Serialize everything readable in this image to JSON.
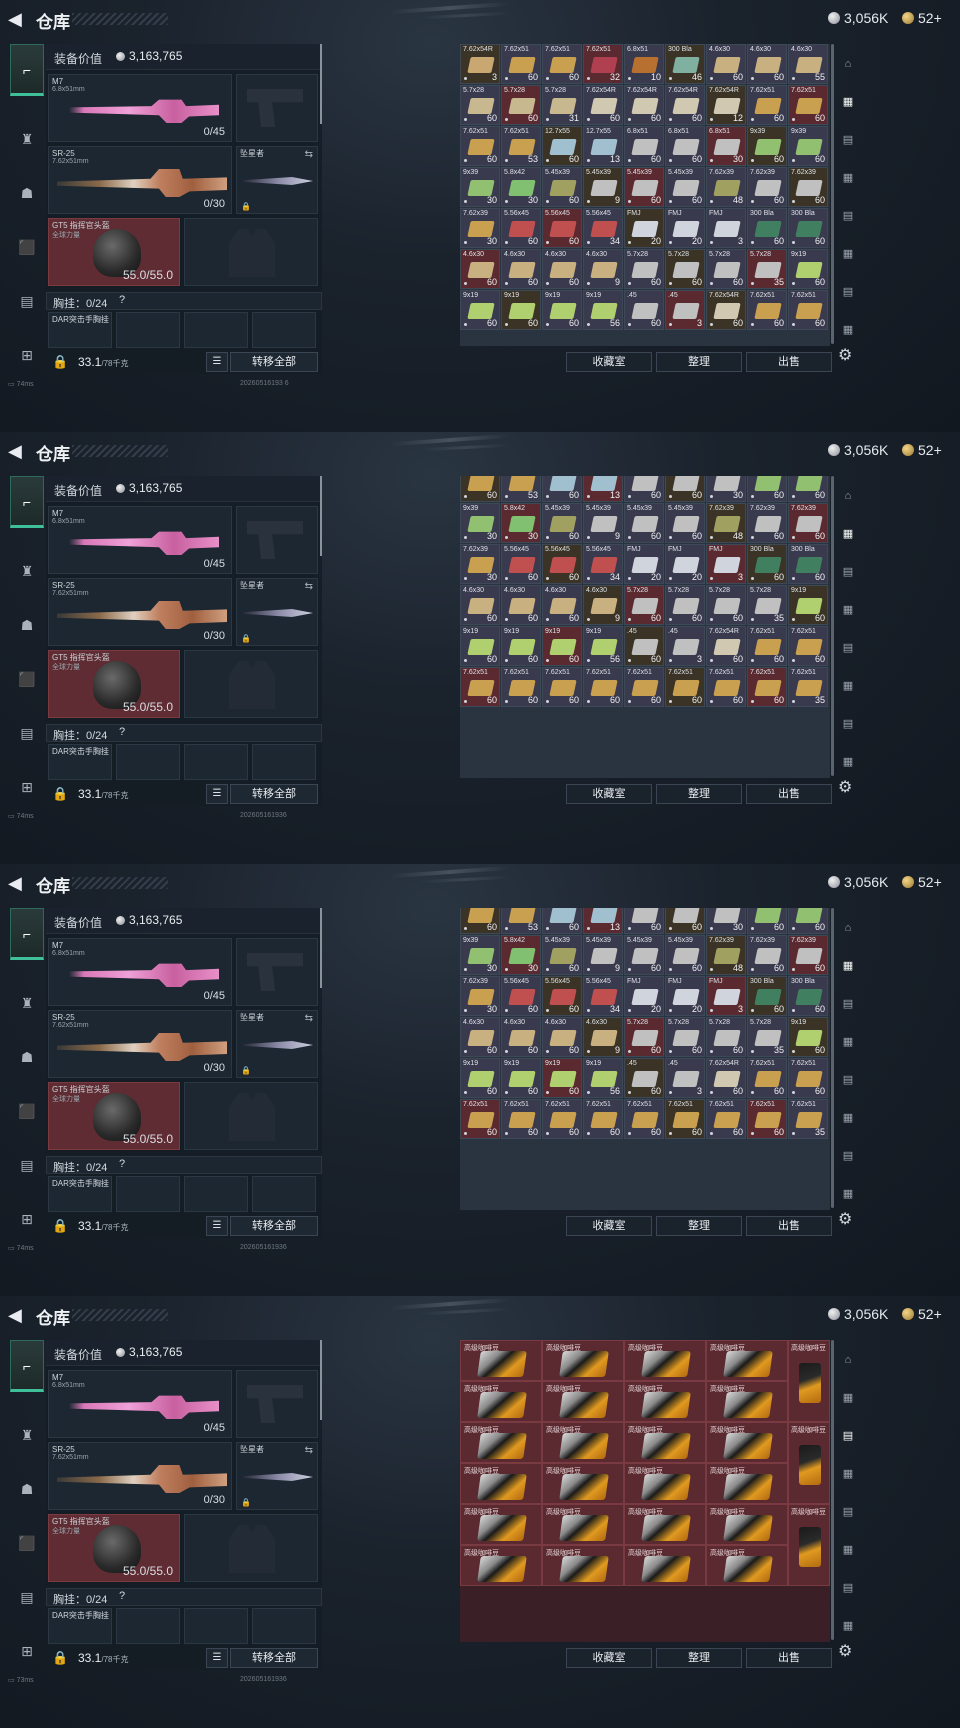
{
  "header": {
    "back_icon": "back-arrow-icon",
    "title": "仓库"
  },
  "currency": {
    "silver": "3,056K",
    "gold": "52+"
  },
  "side_tabs": [
    "weapons-tab",
    "armor-tab",
    "backpack-tab",
    "bag-tab",
    "case-tab",
    "toolbox-tab"
  ],
  "loadout": {
    "value_label": "装备价值",
    "value": "3,163,765",
    "primary": {
      "name": "M7",
      "caliber": "6.8x51mm",
      "ammo": "0/45"
    },
    "secondary": {
      "name": "SR-25",
      "caliber": "7.62x51mm",
      "ammo": "0/30"
    },
    "melee": {
      "name": "坠星者"
    },
    "helmet": {
      "name": "GT5 指挥官头盔",
      "sub": "全球力量",
      "durability": "55.0/55.0"
    },
    "rig": {
      "label": "胸挂：",
      "value": "0/24",
      "help": "?"
    },
    "armor": {
      "name": "DAR突击手胸挂"
    },
    "weight": {
      "value": "33.1",
      "max": "/78千克"
    },
    "transfer_label": "转移全部"
  },
  "status": [
    {
      "ping": "74ms",
      "code": "20260516193 6"
    },
    {
      "ping": "74ms",
      "code": "202605161936"
    },
    {
      "ping": "74ms",
      "code": "202605161936"
    },
    {
      "ping": "73ms",
      "code": "202605161936"
    }
  ],
  "grid_buttons": {
    "collection": "收藏室",
    "sort": "整理",
    "sell": "出售"
  },
  "ammo_grid_1": [
    [
      "7.62x54R",
      "3",
      "#c8a870"
    ],
    [
      "7.62x51",
      "60",
      "#c8a050"
    ],
    [
      "7.62x51",
      "60",
      "#c8a050"
    ],
    [
      "7.62x51",
      "32",
      "#b04050"
    ],
    [
      "6.8x51",
      "10",
      "#b87030"
    ],
    [
      "300 Bla",
      "46",
      "#80b0a0"
    ],
    [
      "4.6x30",
      "60",
      "#c8b080"
    ],
    [
      "4.6x30",
      "60",
      "#c8b080"
    ],
    [
      "4.6x30",
      "55",
      "#c8b080"
    ],
    [
      "5.7x28",
      "60",
      "#c8b890"
    ],
    [
      "5.7x28",
      "60",
      "#c8b890"
    ],
    [
      "5.7x28",
      "31",
      "#c8b890"
    ],
    [
      "7.62x54R",
      "60",
      "#d0c8b0"
    ],
    [
      "7.62x54R",
      "60",
      "#d0c8b0"
    ],
    [
      "7.62x54R",
      "60",
      "#d0c8b0"
    ],
    [
      "7.62x54R",
      "12",
      "#d0c8b0"
    ],
    [
      "7.62x51",
      "60",
      "#c8a050"
    ],
    [
      "7.62x51",
      "60",
      "#c8a050"
    ],
    [
      "7.62x51",
      "60",
      "#c8a050"
    ],
    [
      "7.62x51",
      "53",
      "#c8a050"
    ],
    [
      "12.7x55",
      "60",
      "#a0c0d0"
    ],
    [
      "12.7x55",
      "13",
      "#a0c0d0"
    ],
    [
      "6.8x51",
      "60",
      "#c0c0c0"
    ],
    [
      "6.8x51",
      "60",
      "#c0c0c0"
    ],
    [
      "6.8x51",
      "30",
      "#c0c0c0"
    ],
    [
      "9x39",
      "60",
      "#90c070"
    ],
    [
      "9x39",
      "60",
      "#90c070"
    ],
    [
      "9x39",
      "30",
      "#90c070"
    ],
    [
      "5.8x42",
      "30",
      "#80c070"
    ],
    [
      "5.45x39",
      "60",
      "#a0a060"
    ],
    [
      "5.45x39",
      "9",
      "#c0c0c0"
    ],
    [
      "5.45x39",
      "60",
      "#c0c0c0"
    ],
    [
      "5.45x39",
      "60",
      "#c0c0c0"
    ],
    [
      "7.62x39",
      "48",
      "#a0a060"
    ],
    [
      "7.62x39",
      "60",
      "#c0c0c0"
    ],
    [
      "7.62x39",
      "60",
      "#c0c0c0"
    ],
    [
      "7.62x39",
      "30",
      "#c8a050"
    ],
    [
      "5.56x45",
      "60",
      "#c05050"
    ],
    [
      "5.56x45",
      "60",
      "#c05050"
    ],
    [
      "5.56x45",
      "34",
      "#c05050"
    ],
    [
      "FMJ",
      "20",
      "#d0d4dc"
    ],
    [
      "FMJ",
      "20",
      "#d0d4dc"
    ],
    [
      "FMJ",
      "3",
      "#d0d4dc"
    ],
    [
      "300 Bla",
      "60",
      "#408060"
    ],
    [
      "300 Bla",
      "60",
      "#408060"
    ],
    [
      "4.6x30",
      "60",
      "#c8b080"
    ],
    [
      "4.6x30",
      "60",
      "#c8b080"
    ],
    [
      "4.6x30",
      "60",
      "#c8b080"
    ],
    [
      "4.6x30",
      "9",
      "#c8b080"
    ],
    [
      "5.7x28",
      "60",
      "#c0c0c0"
    ],
    [
      "5.7x28",
      "60",
      "#c0c0c0"
    ],
    [
      "5.7x28",
      "60",
      "#c0c0c0"
    ],
    [
      "5.7x28",
      "35",
      "#c0c0c0"
    ],
    [
      "9x19",
      "60",
      "#b0d070"
    ],
    [
      "9x19",
      "60",
      "#b0d070"
    ],
    [
      "9x19",
      "60",
      "#b0d070"
    ],
    [
      "9x19",
      "60",
      "#b0d070"
    ],
    [
      "9x19",
      "56",
      "#b0d070"
    ],
    [
      ".45",
      "60",
      "#c0c0c0"
    ],
    [
      ".45",
      "3",
      "#c0c0c0"
    ],
    [
      "7.62x54R",
      "60",
      "#d0c8b0"
    ],
    [
      "7.62x51",
      "60",
      "#c8a050"
    ],
    [
      "7.62x51",
      "60",
      "#c8a050"
    ]
  ],
  "ammo_grid_2": [
    [
      "7.62x51",
      "60",
      "#c8a050"
    ],
    [
      "7.62x51",
      "53",
      "#c8a050"
    ],
    [
      "12.7x55",
      "60",
      "#a0c0d0"
    ],
    [
      "12.7x55",
      "13",
      "#a0c0d0"
    ],
    [
      "6.8x51",
      "60",
      "#c0c0c0"
    ],
    [
      "6.8x51",
      "60",
      "#c0c0c0"
    ],
    [
      "6.8x51",
      "30",
      "#c0c0c0"
    ],
    [
      "9x39",
      "60",
      "#90c070"
    ],
    [
      "9x39",
      "60",
      "#90c070"
    ],
    [
      "9x39",
      "30",
      "#90c070"
    ],
    [
      "5.8x42",
      "30",
      "#80c070"
    ],
    [
      "5.45x39",
      "60",
      "#a0a060"
    ],
    [
      "5.45x39",
      "9",
      "#c0c0c0"
    ],
    [
      "5.45x39",
      "60",
      "#c0c0c0"
    ],
    [
      "5.45x39",
      "60",
      "#c0c0c0"
    ],
    [
      "7.62x39",
      "48",
      "#a0a060"
    ],
    [
      "7.62x39",
      "60",
      "#c0c0c0"
    ],
    [
      "7.62x39",
      "60",
      "#c0c0c0"
    ],
    [
      "7.62x39",
      "30",
      "#c8a050"
    ],
    [
      "5.56x45",
      "60",
      "#c05050"
    ],
    [
      "5.56x45",
      "60",
      "#c05050"
    ],
    [
      "5.56x45",
      "34",
      "#c05050"
    ],
    [
      "FMJ",
      "20",
      "#d0d4dc"
    ],
    [
      "FMJ",
      "20",
      "#d0d4dc"
    ],
    [
      "FMJ",
      "3",
      "#d0d4dc"
    ],
    [
      "300 Bla",
      "60",
      "#408060"
    ],
    [
      "300 Bla",
      "60",
      "#408060"
    ],
    [
      "4.6x30",
      "60",
      "#c8b080"
    ],
    [
      "4.6x30",
      "60",
      "#c8b080"
    ],
    [
      "4.6x30",
      "60",
      "#c8b080"
    ],
    [
      "4.6x30",
      "9",
      "#c8b080"
    ],
    [
      "5.7x28",
      "60",
      "#c0c0c0"
    ],
    [
      "5.7x28",
      "60",
      "#c0c0c0"
    ],
    [
      "5.7x28",
      "60",
      "#c0c0c0"
    ],
    [
      "5.7x28",
      "35",
      "#c0c0c0"
    ],
    [
      "9x19",
      "60",
      "#b0d070"
    ],
    [
      "9x19",
      "60",
      "#b0d070"
    ],
    [
      "9x19",
      "60",
      "#b0d070"
    ],
    [
      "9x19",
      "60",
      "#b0d070"
    ],
    [
      "9x19",
      "56",
      "#b0d070"
    ],
    [
      ".45",
      "60",
      "#c0c0c0"
    ],
    [
      ".45",
      "3",
      "#c0c0c0"
    ],
    [
      "7.62x54R",
      "60",
      "#d0c8b0"
    ],
    [
      "7.62x51",
      "60",
      "#c8a050"
    ],
    [
      "7.62x51",
      "60",
      "#c8a050"
    ],
    [
      "7.62x51",
      "60",
      "#c8a050"
    ],
    [
      "7.62x51",
      "60",
      "#c8a050"
    ],
    [
      "7.62x51",
      "60",
      "#c8a050"
    ],
    [
      "7.62x51",
      "60",
      "#c8a050"
    ],
    [
      "7.62x51",
      "60",
      "#c8a050"
    ],
    [
      "7.62x51",
      "60",
      "#c8a050"
    ],
    [
      "7.62x51",
      "60",
      "#c8a050"
    ],
    [
      "7.62x51",
      "60",
      "#c8a050"
    ],
    [
      "7.62x51",
      "35",
      "#c8a050"
    ]
  ],
  "coffee": {
    "name": "高级咖啡豆"
  }
}
